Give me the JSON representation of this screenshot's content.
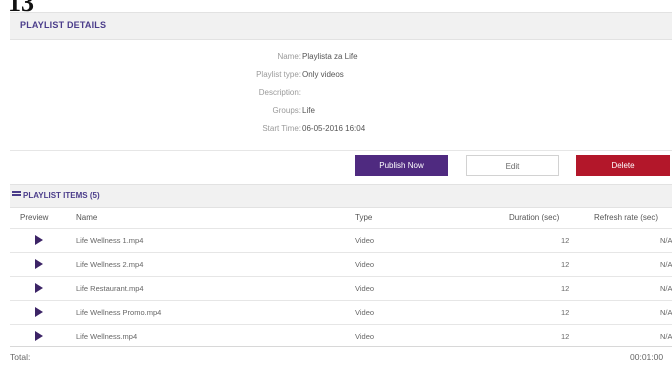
{
  "page": {
    "number": "13"
  },
  "details": {
    "title": "PLAYLIST DETAILS",
    "fields": [
      {
        "label": "Name:",
        "value": "Playlista za Life"
      },
      {
        "label": "Playlist type:",
        "value": "Only videos"
      },
      {
        "label": "Description:",
        "value": ""
      },
      {
        "label": "Groups:",
        "value": "Life"
      },
      {
        "label": "Start Time:",
        "value": "06-05-2016 16:04"
      }
    ]
  },
  "actions": {
    "publish": "Publish Now",
    "edit": "Edit",
    "delete": "Delete",
    "colors": {
      "publish": "#4f2a80",
      "delete": "#b3172a"
    }
  },
  "items": {
    "title": "PLAYLIST ITEMS (5)",
    "icon": "list-icon",
    "columns": [
      "Preview",
      "Name",
      "Type",
      "Duration (sec)",
      "Refresh rate (sec)"
    ],
    "rows": [
      {
        "preview_icon": "play-icon",
        "name": "Life Wellness 1.mp4",
        "type": "Video",
        "duration": "12",
        "refresh": "N/A"
      },
      {
        "preview_icon": "play-icon",
        "name": "Life Wellness 2.mp4",
        "type": "Video",
        "duration": "12",
        "refresh": "N/A"
      },
      {
        "preview_icon": "play-icon",
        "name": "Life Restaurant.mp4",
        "type": "Video",
        "duration": "12",
        "refresh": "N/A"
      },
      {
        "preview_icon": "play-icon",
        "name": "Life Wellness Promo.mp4",
        "type": "Video",
        "duration": "12",
        "refresh": "N/A"
      },
      {
        "preview_icon": "play-icon",
        "name": "Life Wellness.mp4",
        "type": "Video",
        "duration": "12",
        "refresh": "N/A"
      }
    ],
    "total_label": "Total:",
    "total_value": "00:01:00"
  }
}
